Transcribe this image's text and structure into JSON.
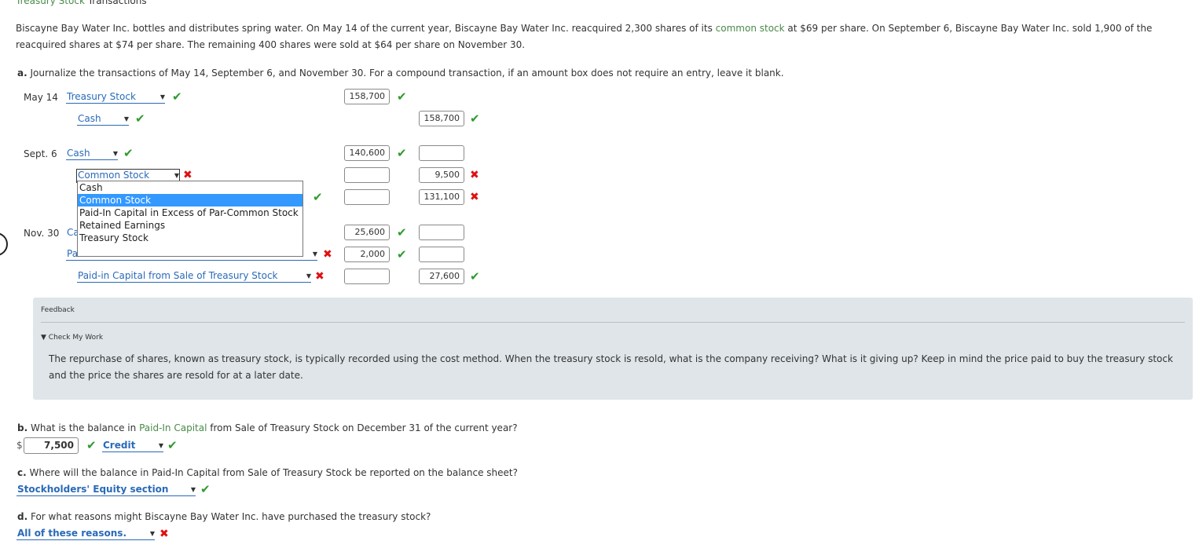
{
  "header": {
    "title_link": "Treasury Stock",
    "title_rest": "Transactions"
  },
  "intro": {
    "part1": "Biscayne Bay Water Inc. bottles and distributes spring water. On May 14 of the current year, Biscayne Bay Water Inc. reacquired 2,300 shares of its ",
    "link": "common stock",
    "part2": " at $69 per share. On September 6, Biscayne Bay Water Inc. sold 1,900 of the reacquired shares at $74 per share. The remaining 400 shares were sold at $64 per share on November 30."
  },
  "part_a": {
    "letter": "a.",
    "text": "Journalize the transactions of May 14, September 6, and November 30. For a compound transaction, if an amount box does not require an entry, leave it blank."
  },
  "journal": {
    "may14": {
      "date": "May 14",
      "row1_account": "Treasury Stock",
      "row1_debit": "158,700",
      "row1_credit": "",
      "row2_account": "Cash",
      "row2_debit": "",
      "row2_credit": "158,700"
    },
    "sept6": {
      "date": "Sept. 6",
      "row1_account": "Cash",
      "row1_debit": "140,600",
      "row1_credit": "",
      "row2_account": "Common Stock",
      "row2_debit": "",
      "row2_credit": "9,500",
      "row3_debit": "",
      "row3_credit": "131,100"
    },
    "nov30": {
      "date": "Nov. 30",
      "row1_account_partial": "Ca",
      "row1_debit": "25,600",
      "row1_credit": "",
      "row2_account_partial": "Pa",
      "row2_debit": "2,000",
      "row2_credit": "",
      "row3_account": "Paid-in Capital from Sale of Treasury Stock",
      "row3_debit": "",
      "row3_credit": "27,600"
    }
  },
  "dropdown_options": [
    "Cash",
    "Common Stock",
    "Paid-In Capital in Excess of Par-Common Stock",
    "Retained Earnings",
    "Treasury Stock"
  ],
  "feedback": {
    "heading": "Feedback",
    "toggle": "▼ Check My Work",
    "text": "The repurchase of shares, known as treasury stock, is typically recorded using the cost method. When the treasury stock is resold, what is the company receiving? What is it giving up? Keep in mind the price paid to buy the treasury stock and the price the shares are resold for at a later date."
  },
  "part_b": {
    "letter": "b.",
    "q1": "What is the balance in ",
    "link": "Paid-In Capital",
    "q2": " from Sale of Treasury Stock on December 31 of the current year?",
    "currency": "$",
    "amount": "7,500",
    "side": "Credit"
  },
  "part_c": {
    "letter": "c.",
    "question": "Where will the balance in Paid-In Capital from Sale of Treasury Stock be reported on the balance sheet?",
    "answer": "Stockholders' Equity section"
  },
  "part_d": {
    "letter": "d.",
    "question": "For what reasons might Biscayne Bay Water Inc. have purchased the treasury stock?",
    "answer": "All of these reasons."
  },
  "icons": {
    "correct": "✔",
    "incorrect": "✖",
    "arrow": "▾"
  },
  "colors": {
    "correct": "#2f9a2f",
    "incorrect": "#dd1111",
    "link": "#2a6ab8",
    "selected": "#3399ff",
    "feedback_bg": "#dfe5e8"
  }
}
